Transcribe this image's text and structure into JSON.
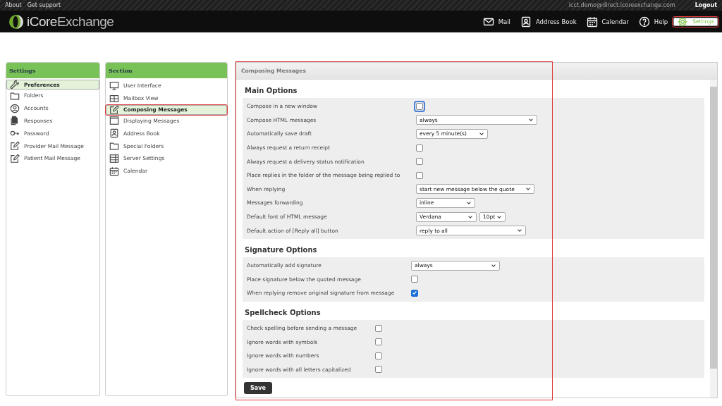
{
  "top_links": [
    "About",
    "Get support"
  ],
  "user": "icct.demo@direct.icoreexchange.com",
  "logout": "Logout",
  "logo": {
    "part1": "iCore",
    "part2": "Exchange"
  },
  "nav": [
    {
      "label": "Mail",
      "selected": false,
      "highlighted": false
    },
    {
      "label": "Address Book",
      "selected": false,
      "highlighted": false
    },
    {
      "label": "Calendar",
      "selected": false,
      "highlighted": false
    },
    {
      "label": "Help",
      "selected": false,
      "highlighted": false
    },
    {
      "label": "Settings",
      "selected": true,
      "highlighted": true
    }
  ],
  "settings_panel": {
    "title": "Settings",
    "items": [
      {
        "label": "Preferences",
        "selected": true
      },
      {
        "label": "Folders",
        "selected": false
      },
      {
        "label": "Accounts",
        "selected": false
      },
      {
        "label": "Responses",
        "selected": false
      },
      {
        "label": "Password",
        "selected": false
      },
      {
        "label": "Provider Mail Message",
        "selected": false
      },
      {
        "label": "Patient Mail Message",
        "selected": false
      }
    ]
  },
  "section_panel": {
    "title": "Section",
    "items": [
      {
        "label": "User Interface",
        "selected": false,
        "highlighted": false
      },
      {
        "label": "Mailbox View",
        "selected": false,
        "highlighted": false
      },
      {
        "label": "Composing Messages",
        "selected": true,
        "highlighted": true
      },
      {
        "label": "Displaying Messages",
        "selected": false,
        "highlighted": false
      },
      {
        "label": "Address Book",
        "selected": false,
        "highlighted": false
      },
      {
        "label": "Special Folders",
        "selected": false,
        "highlighted": false
      },
      {
        "label": "Server Settings",
        "selected": false,
        "highlighted": false
      },
      {
        "label": "Calendar",
        "selected": false,
        "highlighted": false
      }
    ]
  },
  "content": {
    "title": "Composing Messages",
    "highlighted": true,
    "groups": [
      {
        "title": "Main Options",
        "rows": [
          {
            "label": "Compose in a new window",
            "kind": "checkbox",
            "checked": false,
            "focused": true
          },
          {
            "label": "Compose HTML messages",
            "kind": "select",
            "value": "always"
          },
          {
            "label": "Automatically save draft",
            "kind": "select",
            "value": "every 5 minute(s)"
          },
          {
            "label": "Always request a return receipt",
            "kind": "checkbox",
            "checked": false,
            "focused": false
          },
          {
            "label": "Always request a delivery status notification",
            "kind": "checkbox",
            "checked": false,
            "focused": false
          },
          {
            "label": "Place replies in the folder of the message being replied to",
            "kind": "checkbox",
            "checked": false,
            "focused": false
          },
          {
            "label": "When replying",
            "kind": "select",
            "value": "start new message below the quote"
          },
          {
            "label": "Messages forwarding",
            "kind": "select",
            "value": "inline"
          },
          {
            "label": "Default font of HTML message",
            "kind": "select_pair",
            "value": "Verdana",
            "value2": "10pt"
          },
          {
            "label": "Default action of [Reply all] button",
            "kind": "select",
            "value": "reply to all"
          }
        ]
      },
      {
        "title": "Signature Options",
        "rows": [
          {
            "label": "Automatically add signature",
            "kind": "select",
            "value": "always"
          },
          {
            "label": "Place signature below the quoted message",
            "kind": "checkbox",
            "checked": false,
            "focused": false
          },
          {
            "label": "When replying remove original signature from message",
            "kind": "checkbox",
            "checked": true,
            "focused": false
          }
        ]
      },
      {
        "title": "Spellcheck Options",
        "rows": [
          {
            "label": "Check spelling before sending a message",
            "kind": "checkbox",
            "checked": false,
            "focused": false
          },
          {
            "label": "Ignore words with symbols",
            "kind": "checkbox",
            "checked": false,
            "focused": false
          },
          {
            "label": "Ignore words with numbers",
            "kind": "checkbox",
            "checked": false,
            "focused": false
          },
          {
            "label": "Ignore words with all letters capitalized",
            "kind": "checkbox",
            "checked": false,
            "focused": false
          }
        ]
      }
    ]
  },
  "save_button": "Save"
}
